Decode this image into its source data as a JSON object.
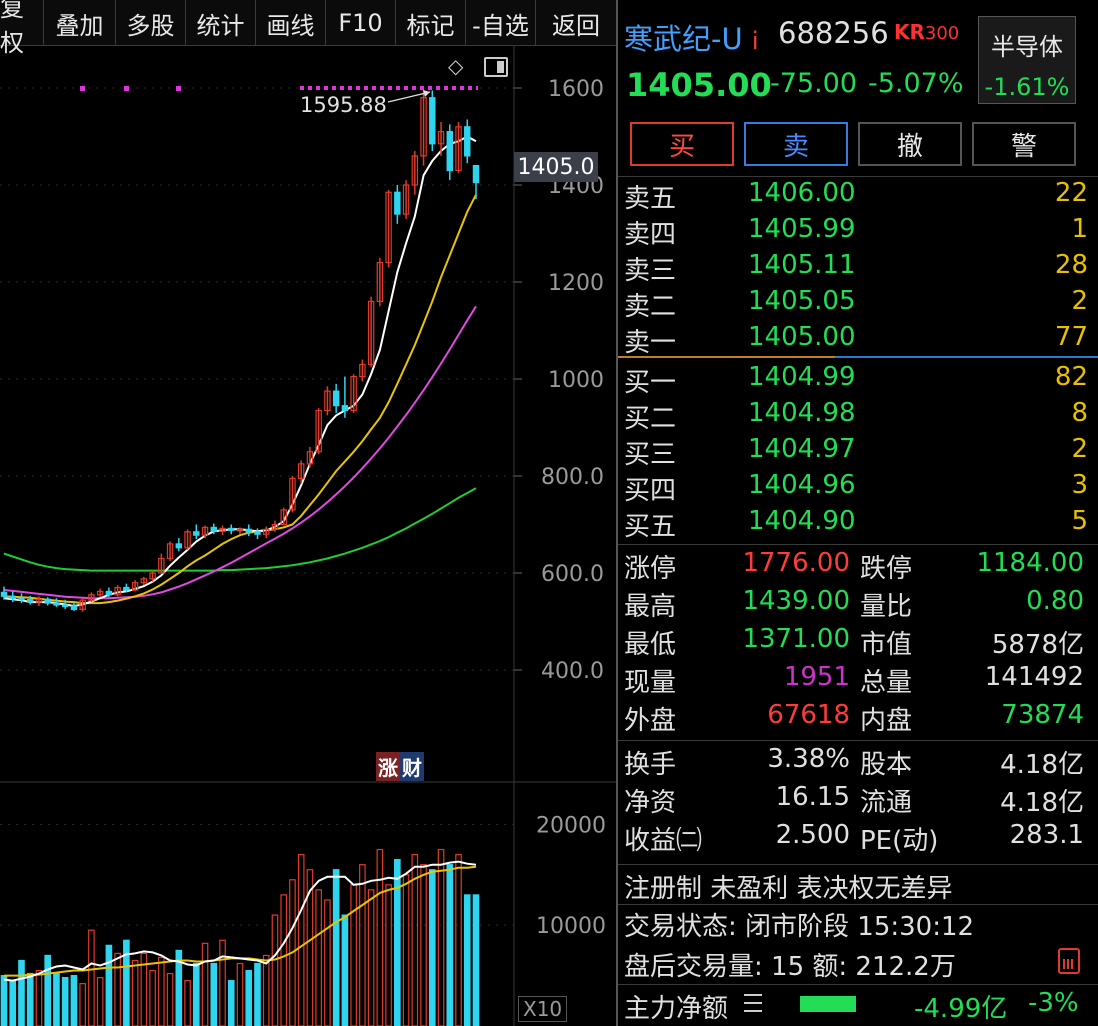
{
  "toolbar": {
    "items": [
      "复权",
      "叠加",
      "多股",
      "统计",
      "画线",
      "F10",
      "标记",
      "-自选",
      "返回"
    ]
  },
  "chart": {
    "peak_label": "1595.88",
    "current_price_tag": "1405.0",
    "price_axis": [
      "1600",
      "1400",
      "1200",
      "1000",
      "800.0",
      "600.0",
      "400.0"
    ],
    "volume_axis": [
      "20000",
      "10000"
    ],
    "volume_unit": "X10",
    "source_badge": [
      "涨",
      "财"
    ],
    "colors": {
      "up": "#e03a2a",
      "down": "#2fd5ef",
      "ma5": "#ffffff",
      "ma10": "#e8c400",
      "ma20": "#e04ae0",
      "ma60": "#22cc33",
      "marker": "#dd33dd"
    }
  },
  "chart_data": {
    "type": "candlestick",
    "y_range": [
      400,
      1600
    ],
    "candles": [
      {
        "o": 560,
        "h": 572,
        "l": 545,
        "c": 552
      },
      {
        "o": 552,
        "h": 562,
        "l": 540,
        "c": 548
      },
      {
        "o": 548,
        "h": 558,
        "l": 538,
        "c": 545
      },
      {
        "o": 545,
        "h": 553,
        "l": 535,
        "c": 540
      },
      {
        "o": 540,
        "h": 552,
        "l": 532,
        "c": 546
      },
      {
        "o": 546,
        "h": 550,
        "l": 533,
        "c": 538
      },
      {
        "o": 538,
        "h": 548,
        "l": 530,
        "c": 534
      },
      {
        "o": 534,
        "h": 545,
        "l": 526,
        "c": 532
      },
      {
        "o": 532,
        "h": 542,
        "l": 522,
        "c": 525
      },
      {
        "o": 525,
        "h": 548,
        "l": 520,
        "c": 544
      },
      {
        "o": 544,
        "h": 560,
        "l": 540,
        "c": 555
      },
      {
        "o": 555,
        "h": 568,
        "l": 550,
        "c": 562
      },
      {
        "o": 562,
        "h": 570,
        "l": 550,
        "c": 555
      },
      {
        "o": 555,
        "h": 575,
        "l": 552,
        "c": 570
      },
      {
        "o": 570,
        "h": 578,
        "l": 560,
        "c": 565
      },
      {
        "o": 565,
        "h": 585,
        "l": 562,
        "c": 580
      },
      {
        "o": 580,
        "h": 592,
        "l": 575,
        "c": 588
      },
      {
        "o": 588,
        "h": 605,
        "l": 582,
        "c": 600
      },
      {
        "o": 600,
        "h": 640,
        "l": 598,
        "c": 630
      },
      {
        "o": 630,
        "h": 665,
        "l": 625,
        "c": 660
      },
      {
        "o": 660,
        "h": 672,
        "l": 645,
        "c": 652
      },
      {
        "o": 652,
        "h": 690,
        "l": 648,
        "c": 685
      },
      {
        "o": 685,
        "h": 700,
        "l": 670,
        "c": 678
      },
      {
        "o": 678,
        "h": 698,
        "l": 672,
        "c": 694
      },
      {
        "o": 694,
        "h": 702,
        "l": 680,
        "c": 686
      },
      {
        "o": 686,
        "h": 698,
        "l": 678,
        "c": 692
      },
      {
        "o": 692,
        "h": 700,
        "l": 680,
        "c": 688
      },
      {
        "o": 688,
        "h": 694,
        "l": 680,
        "c": 690
      },
      {
        "o": 690,
        "h": 700,
        "l": 676,
        "c": 685
      },
      {
        "o": 685,
        "h": 692,
        "l": 670,
        "c": 680
      },
      {
        "o": 680,
        "h": 696,
        "l": 672,
        "c": 690
      },
      {
        "o": 690,
        "h": 708,
        "l": 685,
        "c": 700
      },
      {
        "o": 700,
        "h": 735,
        "l": 698,
        "c": 730
      },
      {
        "o": 730,
        "h": 800,
        "l": 725,
        "c": 795
      },
      {
        "o": 795,
        "h": 832,
        "l": 785,
        "c": 825
      },
      {
        "o": 825,
        "h": 860,
        "l": 818,
        "c": 850
      },
      {
        "o": 850,
        "h": 940,
        "l": 845,
        "c": 935
      },
      {
        "o": 935,
        "h": 985,
        "l": 925,
        "c": 975
      },
      {
        "o": 975,
        "h": 990,
        "l": 930,
        "c": 945
      },
      {
        "o": 945,
        "h": 1005,
        "l": 920,
        "c": 935
      },
      {
        "o": 935,
        "h": 1010,
        "l": 930,
        "c": 1005
      },
      {
        "o": 1005,
        "h": 1040,
        "l": 995,
        "c": 1030
      },
      {
        "o": 1030,
        "h": 1170,
        "l": 1025,
        "c": 1160
      },
      {
        "o": 1160,
        "h": 1250,
        "l": 1150,
        "c": 1240
      },
      {
        "o": 1240,
        "h": 1390,
        "l": 1230,
        "c": 1385
      },
      {
        "o": 1385,
        "h": 1400,
        "l": 1320,
        "c": 1340
      },
      {
        "o": 1340,
        "h": 1410,
        "l": 1330,
        "c": 1400
      },
      {
        "o": 1400,
        "h": 1470,
        "l": 1380,
        "c": 1460
      },
      {
        "o": 1460,
        "h": 1595.88,
        "l": 1440,
        "c": 1580
      },
      {
        "o": 1580,
        "h": 1595,
        "l": 1470,
        "c": 1485
      },
      {
        "o": 1485,
        "h": 1530,
        "l": 1460,
        "c": 1510
      },
      {
        "o": 1510,
        "h": 1525,
        "l": 1410,
        "c": 1430
      },
      {
        "o": 1430,
        "h": 1530,
        "l": 1425,
        "c": 1520
      },
      {
        "o": 1520,
        "h": 1535,
        "l": 1445,
        "c": 1460
      },
      {
        "o": 1440,
        "h": 1439,
        "l": 1371,
        "c": 1405
      }
    ],
    "ma5": [
      548,
      546,
      544,
      540,
      540,
      540,
      538,
      535,
      532,
      535,
      541,
      548,
      555,
      560,
      562,
      567,
      573,
      582,
      595,
      615,
      632,
      648,
      665,
      677,
      686,
      688,
      690,
      690,
      688,
      686,
      688,
      695,
      707,
      741,
      781,
      825,
      864,
      905,
      925,
      935,
      945,
      968,
      1010,
      1060,
      1140,
      1220,
      1280,
      1335,
      1420,
      1450,
      1470,
      1485,
      1490,
      1500,
      1490
    ],
    "ma10": [
      552,
      551,
      550,
      549,
      547,
      545,
      543,
      541,
      540,
      538,
      538,
      538,
      540,
      543,
      547,
      552,
      558,
      566,
      576,
      588,
      600,
      614,
      626,
      636,
      648,
      660,
      670,
      678,
      683,
      686,
      688,
      690,
      694,
      700,
      718,
      740,
      762,
      786,
      810,
      830,
      850,
      872,
      896,
      920,
      952,
      990,
      1030,
      1070,
      1115,
      1160,
      1210,
      1255,
      1300,
      1345,
      1380
    ],
    "ma20": [
      565,
      563,
      561,
      559,
      557,
      555,
      553,
      551,
      550,
      549,
      548,
      548,
      548,
      549,
      550,
      551,
      553,
      556,
      560,
      566,
      572,
      579,
      587,
      595,
      603,
      612,
      621,
      631,
      641,
      651,
      661,
      671,
      681,
      692,
      704,
      717,
      731,
      746,
      762,
      779,
      797,
      816,
      836,
      857,
      879,
      902,
      926,
      951,
      977,
      1004,
      1032,
      1061,
      1091,
      1121,
      1150
    ],
    "ma60": [
      640,
      634,
      628,
      622,
      617,
      613,
      610,
      608,
      607,
      606,
      605,
      605,
      605,
      605,
      605,
      605,
      605,
      605,
      605,
      605,
      605,
      605,
      605,
      605,
      605,
      606,
      606,
      607,
      608,
      609,
      610,
      612,
      614,
      616,
      619,
      622,
      626,
      630,
      635,
      640,
      646,
      652,
      659,
      666,
      674,
      683,
      692,
      702,
      712,
      722,
      733,
      744,
      755,
      765,
      775
    ],
    "volumes": [
      5000,
      4500,
      6500,
      5200,
      5500,
      7000,
      5200,
      4800,
      5000,
      4200,
      9500,
      4800,
      8000,
      7200,
      8500,
      6500,
      7200,
      5500,
      6800,
      5200,
      7500,
      4500,
      6200,
      8200,
      6200,
      8500,
      4500,
      6200,
      5500,
      6200,
      7000,
      11000,
      13000,
      14500,
      17000,
      15500,
      13500,
      12500,
      15500,
      11000,
      14000,
      16000,
      13500,
      17500,
      14000,
      16500,
      15000,
      17000,
      16000,
      15500,
      17500,
      16000,
      17000,
      13000,
      13000
    ],
    "vol_ma5": [
      4600,
      4500,
      4700,
      4900,
      5200,
      5600,
      5900,
      6000,
      5800,
      5600,
      6200,
      6000,
      6300,
      6700,
      7100,
      7200,
      7400,
      7300,
      7000,
      6500,
      6400,
      6100,
      6000,
      6400,
      6500,
      6900,
      6800,
      6700,
      6600,
      6500,
      6200,
      7000,
      8200,
      9700,
      11500,
      13400,
      14400,
      14800,
      14800,
      14800,
      14000,
      14100,
      14400,
      14500,
      14700,
      14600,
      15100,
      15800,
      15800,
      16000,
      16000,
      16200,
      16300,
      16100,
      16000
    ],
    "vol_ma10": [
      5000,
      5000,
      5000,
      5100,
      5100,
      5200,
      5300,
      5400,
      5500,
      5500,
      5600,
      5700,
      5800,
      5800,
      5900,
      6000,
      6100,
      6200,
      6300,
      6400,
      6500,
      6500,
      6400,
      6400,
      6500,
      6600,
      6700,
      6700,
      6700,
      6600,
      6500,
      6600,
      6900,
      7300,
      7900,
      8500,
      9100,
      9700,
      10300,
      10800,
      11400,
      12000,
      12600,
      13200,
      13500,
      13700,
      14100,
      14600,
      15000,
      15300,
      15400,
      15500,
      15700,
      15700,
      15800
    ]
  },
  "quote": {
    "name": "寒武纪-U",
    "flag": "i",
    "code": "688256",
    "index_tag": "KR",
    "index_num": "300",
    "sector_name": "半导体",
    "sector_change": "-1.61%",
    "price": "1405.00",
    "change": "-75.00",
    "change_pct": "-5.07%"
  },
  "buttons": {
    "buy": "买",
    "sell": "卖",
    "cancel": "撤",
    "alert": "警"
  },
  "order_book": {
    "asks": [
      {
        "label": "卖五",
        "price": "1406.00",
        "vol": "22"
      },
      {
        "label": "卖四",
        "price": "1405.99",
        "vol": "1"
      },
      {
        "label": "卖三",
        "price": "1405.11",
        "vol": "28"
      },
      {
        "label": "卖二",
        "price": "1405.05",
        "vol": "2"
      },
      {
        "label": "卖一",
        "price": "1405.00",
        "vol": "77"
      }
    ],
    "bids": [
      {
        "label": "买一",
        "price": "1404.99",
        "vol": "82"
      },
      {
        "label": "买二",
        "price": "1404.98",
        "vol": "8"
      },
      {
        "label": "买三",
        "price": "1404.97",
        "vol": "2"
      },
      {
        "label": "买四",
        "price": "1404.96",
        "vol": "3"
      },
      {
        "label": "买五",
        "price": "1404.90",
        "vol": "5"
      }
    ]
  },
  "stats": {
    "limit_up_label": "涨停",
    "limit_up": "1776.00",
    "limit_down_label": "跌停",
    "limit_down": "1184.00",
    "high_label": "最高",
    "high": "1439.00",
    "vol_ratio_label": "量比",
    "vol_ratio": "0.80",
    "low_label": "最低",
    "low": "1371.00",
    "mktcap_label": "市值",
    "mktcap": "5878亿",
    "cur_vol_label": "现量",
    "cur_vol": "1951",
    "total_vol_label": "总量",
    "total_vol": "141492",
    "outer_label": "外盘",
    "outer": "67618",
    "inner_label": "内盘",
    "inner": "73874"
  },
  "fundamentals": {
    "turnover_label": "换手",
    "turnover": "3.38%",
    "shares_label": "股本",
    "shares": "4.18亿",
    "nav_label": "净资",
    "nav": "16.15",
    "float_label": "流通",
    "float": "4.18亿",
    "eps_label": "收益㈡",
    "eps": "2.500",
    "pe_label": "PE(动)",
    "pe": "283.1"
  },
  "info": {
    "flags": "注册制 未盈利 表决权无差异",
    "status": "交易状态: 闭市阶段 15:30:12",
    "after_hours": "盘后交易量: 15  额: 212.2万",
    "mainflow_label": "主力净额",
    "mainflow_value": "-4.99亿",
    "mainflow_pct": "-3%"
  }
}
